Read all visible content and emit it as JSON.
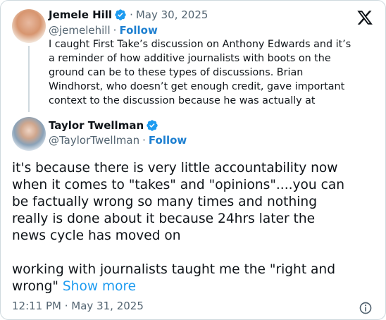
{
  "quoted_tweet": {
    "author_name": "Jemele Hill",
    "handle": "@jemelehill",
    "date": "May 30, 2025",
    "follow_label": "Follow",
    "text": "I caught First Take’s discussion on Anthony Edwards and it’s\na reminder of how additive journalists with boots on the\nground can be to these types of discussions. Brian\nWindhorst, who doesn’t get enough credit, gave important\ncontext to the discussion because he was actually at"
  },
  "tweet": {
    "author_name": "Taylor Twellman",
    "handle": "@TaylorTwellman",
    "follow_label": "Follow",
    "text": "it's because there is very little accountability now\nwhen it comes to \"takes\" and \"opinions\"....you can\nbe factually wrong so many times and nothing\nreally is done about it because 24hrs later the\nnews cycle has moved on\n\nworking with journalists taught me the \"right and\nwrong\" ",
    "show_more_label": "Show more",
    "timestamp": "12:11 PM · May 31, 2025"
  },
  "colors": {
    "verified": "#1d9bf0",
    "link": "#1d9bf0",
    "muted": "#536471"
  },
  "icons": [
    "x-logo-icon",
    "verified-badge-icon",
    "info-icon"
  ]
}
